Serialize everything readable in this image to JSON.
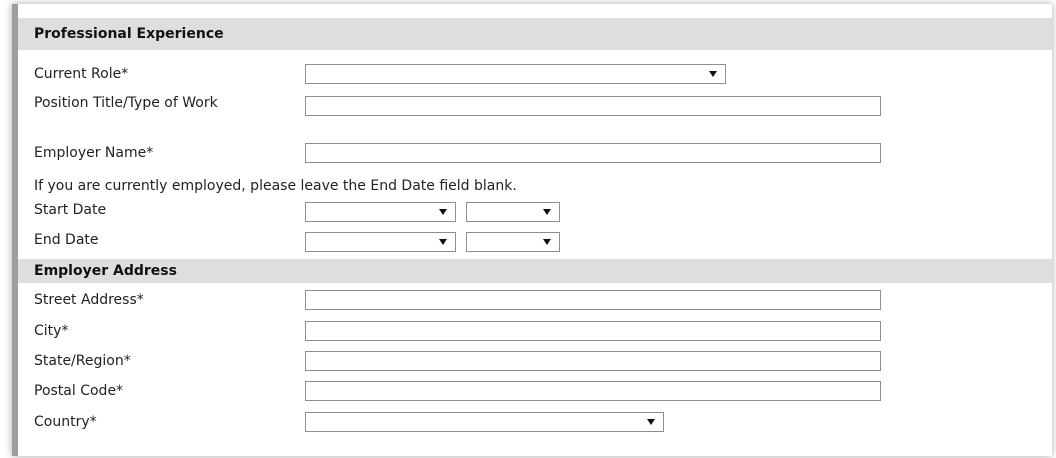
{
  "sections": {
    "professional": {
      "title": "Professional Experience",
      "current_role": {
        "label": "Current Role*",
        "value": ""
      },
      "position_title": {
        "label": "Position Title/Type of Work",
        "value": ""
      },
      "employer_name": {
        "label": "Employer Name*",
        "value": ""
      },
      "note": "If you are currently employed, please leave the End Date field blank.",
      "start_date": {
        "label": "Start Date",
        "month": "",
        "year": ""
      },
      "end_date": {
        "label": "End Date",
        "month": "",
        "year": ""
      }
    },
    "address": {
      "title": "Employer Address",
      "street": {
        "label": "Street Address*",
        "value": ""
      },
      "city": {
        "label": "City*",
        "value": ""
      },
      "state": {
        "label": "State/Region*",
        "value": ""
      },
      "postal": {
        "label": "Postal Code*",
        "value": ""
      },
      "country": {
        "label": "Country*",
        "value": ""
      }
    }
  },
  "icons": {
    "dropdown": "chevron-down-icon"
  },
  "colors": {
    "section_header_bg": "#dedede",
    "left_bar": "#9e9e9e",
    "input_border": "#8e8e8e"
  }
}
